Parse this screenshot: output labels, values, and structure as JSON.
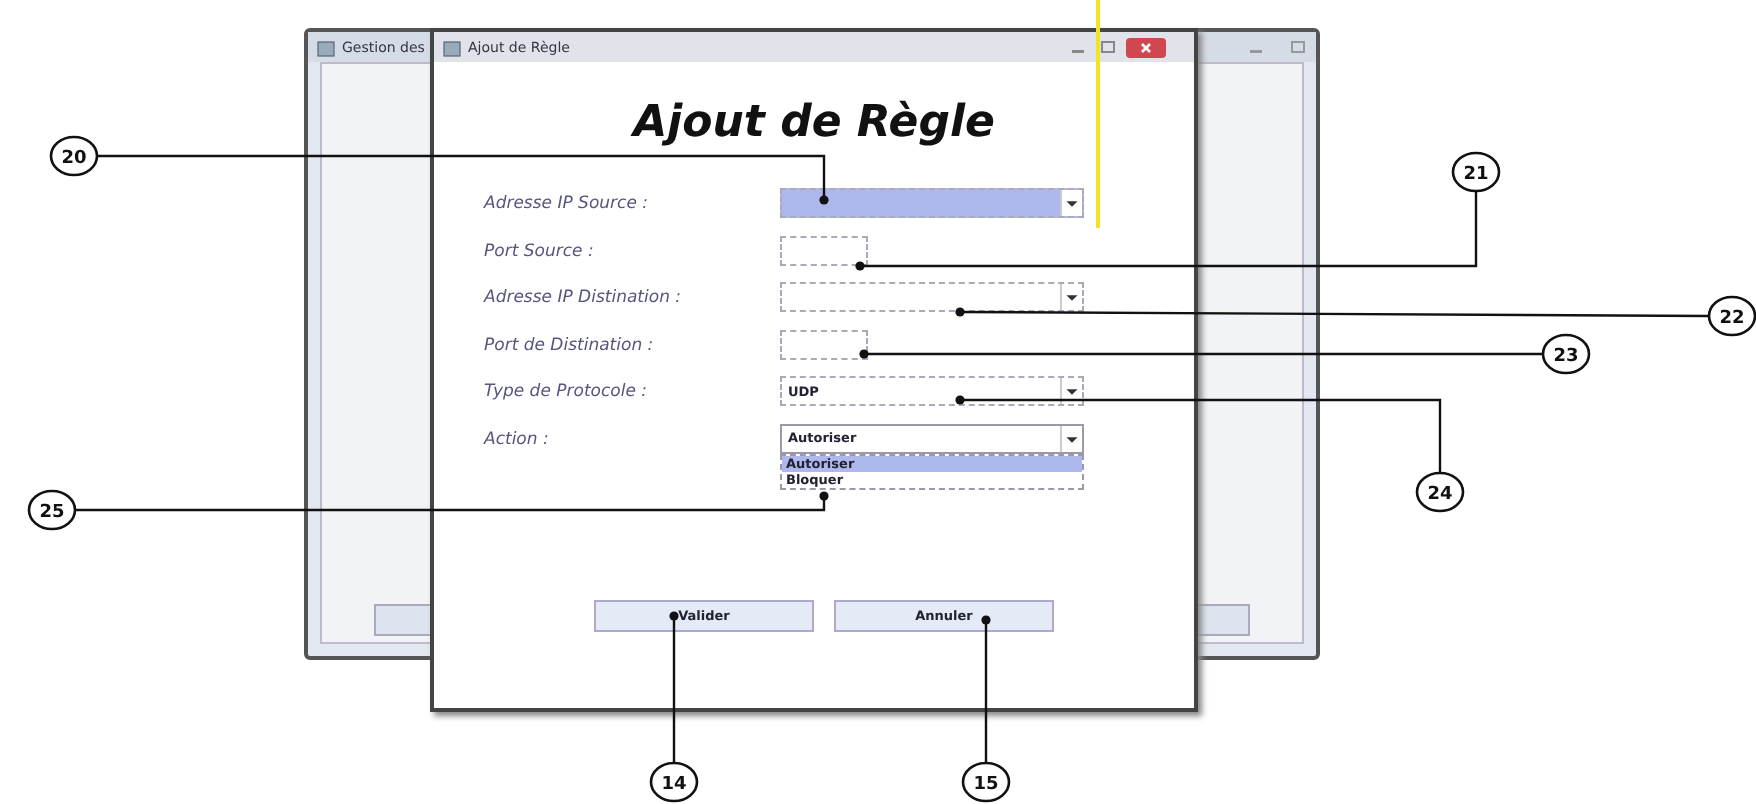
{
  "back_window": {
    "title": "Gestion des"
  },
  "dialog": {
    "title": "Ajout de Règle",
    "heading": "Ajout de Règle",
    "fields": [
      {
        "label": "Adresse IP Source :",
        "kind": "combo",
        "focused": true
      },
      {
        "label": "Port Source :",
        "kind": "text",
        "focused": false
      },
      {
        "label": "Adresse IP Distination :",
        "kind": "combo",
        "focused": false
      },
      {
        "label": "Port de Distination :",
        "kind": "text",
        "focused": false
      },
      {
        "label": "Type de Protocole :",
        "kind": "combo",
        "value": "UDP",
        "focused": false
      },
      {
        "label": "Action :",
        "kind": "combo",
        "value": "Autoriser",
        "focused": false,
        "open": true,
        "options": [
          {
            "label": "Autoriser",
            "selected": true
          },
          {
            "label": "Bloquer",
            "selected": false
          }
        ]
      }
    ],
    "buttons": [
      "Valider",
      "Annuler"
    ]
  },
  "callouts": [
    {
      "number": "20"
    },
    {
      "number": "21"
    },
    {
      "number": "22"
    },
    {
      "number": "23"
    },
    {
      "number": "24"
    },
    {
      "number": "25"
    },
    {
      "number": "14"
    },
    {
      "number": "15"
    }
  ]
}
